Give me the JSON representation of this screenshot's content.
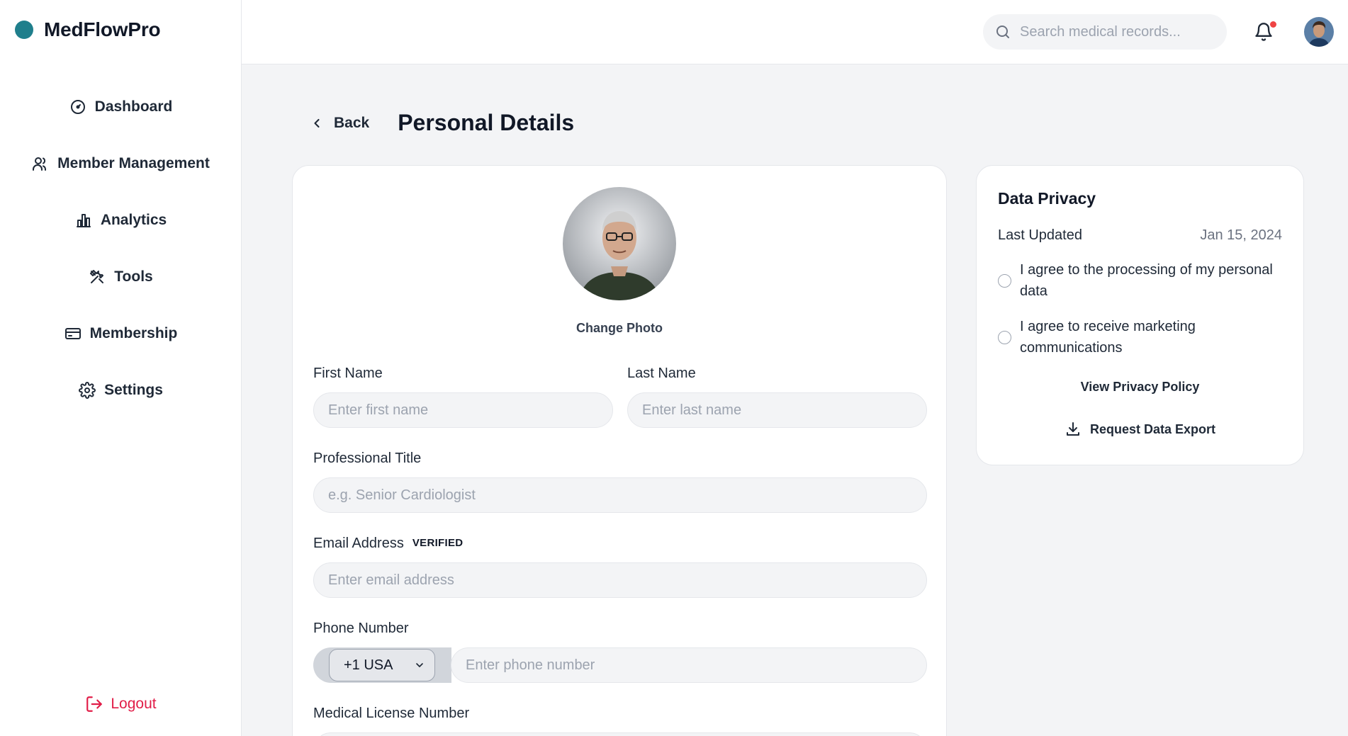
{
  "brand": {
    "name": "MedFlowPro",
    "accent": "#1f7f8c"
  },
  "sidebar": {
    "items": [
      {
        "label": "Dashboard",
        "icon": "gauge-icon"
      },
      {
        "label": "Member Management",
        "icon": "users-icon"
      },
      {
        "label": "Analytics",
        "icon": "bar-chart-icon"
      },
      {
        "label": "Tools",
        "icon": "tools-icon"
      },
      {
        "label": "Membership",
        "icon": "credit-card-icon"
      },
      {
        "label": "Settings",
        "icon": "gear-icon"
      }
    ],
    "logout_label": "Logout",
    "logout_color": "#e11d48"
  },
  "header": {
    "search_placeholder": "Search medical records...",
    "notification_dot_color": "#ef4444"
  },
  "page": {
    "back_label": "Back",
    "title": "Personal Details"
  },
  "form": {
    "change_photo_label": "Change Photo",
    "first_name": {
      "label": "First Name",
      "placeholder": "Enter first name",
      "value": ""
    },
    "last_name": {
      "label": "Last Name",
      "placeholder": "Enter last name",
      "value": ""
    },
    "professional_title": {
      "label": "Professional Title",
      "placeholder": "e.g. Senior Cardiologist",
      "value": ""
    },
    "email": {
      "label": "Email Address",
      "badge": "VERIFIED",
      "placeholder": "Enter email address",
      "value": ""
    },
    "phone": {
      "label": "Phone Number",
      "country_code": "+1 USA",
      "placeholder": "Enter phone number",
      "value": ""
    },
    "license": {
      "label": "Medical License Number"
    }
  },
  "privacy": {
    "title": "Data Privacy",
    "last_updated_label": "Last Updated",
    "last_updated_value": "Jan 15, 2024",
    "consents": [
      {
        "label": "I agree to the processing of my personal data",
        "checked": false
      },
      {
        "label": "I agree to receive marketing communications",
        "checked": false
      }
    ],
    "policy_link": "View Privacy Policy",
    "export_label": "Request Data Export"
  }
}
